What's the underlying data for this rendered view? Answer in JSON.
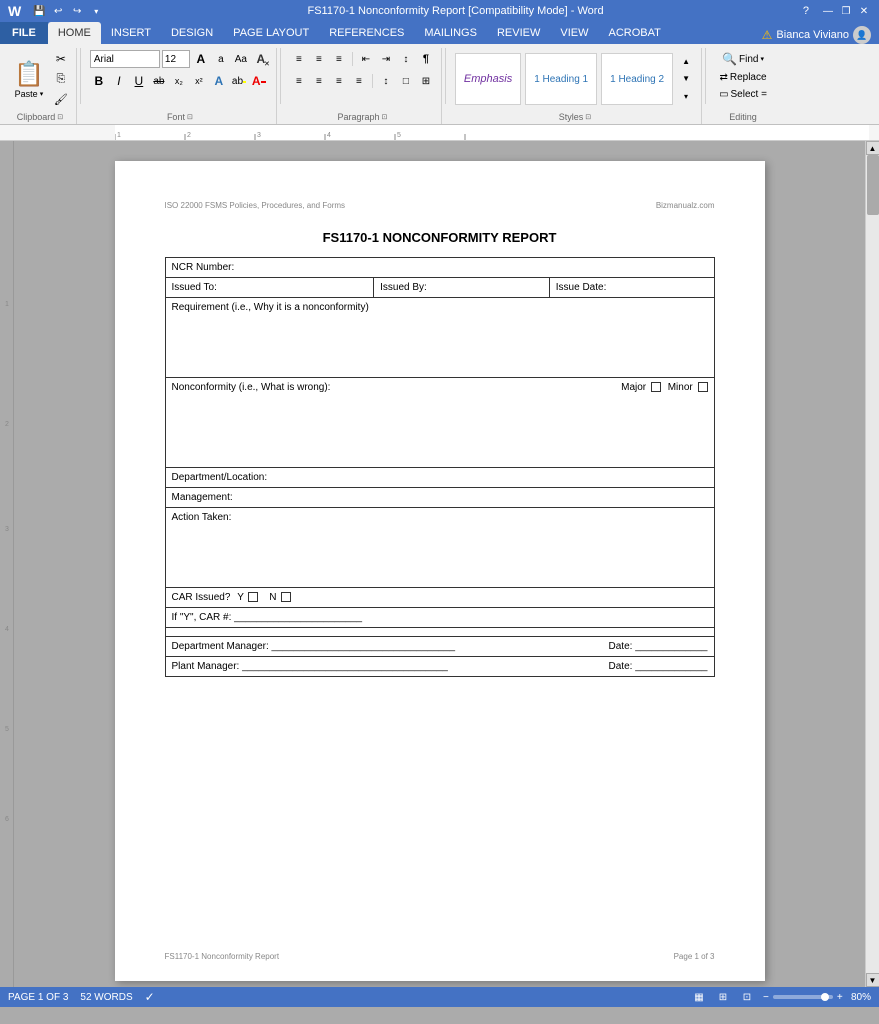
{
  "titleBar": {
    "title": "FS1170-1 Nonconformity Report [Compatibility Mode] - Word",
    "helpBtn": "?",
    "minimizeBtn": "—",
    "restoreBtn": "❐",
    "closeBtn": "✕"
  },
  "quickAccess": {
    "save": "💾",
    "undo": "↩",
    "redo": "↪",
    "more": "▾"
  },
  "ribbonTabs": {
    "file": "FILE",
    "tabs": [
      "HOME",
      "INSERT",
      "DESIGN",
      "PAGE LAYOUT",
      "REFERENCES",
      "MAILINGS",
      "REVIEW",
      "VIEW",
      "ACROBAT"
    ],
    "activeTab": "HOME"
  },
  "user": {
    "warningIcon": "⚠",
    "name": "Bianca Viviano"
  },
  "ribbon": {
    "clipboard": {
      "label": "Clipboard",
      "pasteLabel": "Paste",
      "cutLabel": "✂",
      "copyLabel": "⎘",
      "formatPainterLabel": "🖌"
    },
    "font": {
      "label": "Font",
      "fontName": "Arial",
      "fontSize": "12",
      "growLabel": "A",
      "shrinkLabel": "a",
      "caseLabel": "Aa",
      "clearLabel": "A",
      "boldLabel": "B",
      "italicLabel": "I",
      "underlineLabel": "U",
      "strikeLabel": "ab",
      "subscriptLabel": "x₂",
      "superscriptLabel": "x²",
      "textEffectsLabel": "A",
      "highlightLabel": "ab",
      "fontColorLabel": "A"
    },
    "paragraph": {
      "label": "Paragraph",
      "bulletsLabel": "≡",
      "numberingLabel": "≡",
      "multiLabel": "≡",
      "decreaseIndentLabel": "←",
      "increaseIndentLabel": "→",
      "sortLabel": "↕",
      "showMarkLabel": "¶",
      "alignLeftLabel": "≡",
      "centerLabel": "≡",
      "alignRightLabel": "≡",
      "justifyLabel": "≡",
      "lineSpacingLabel": "↕",
      "shadingLabel": "□",
      "bordersLabel": "□"
    },
    "styles": {
      "label": "Styles",
      "items": [
        {
          "name": "Emphasis",
          "display": "Emphasis",
          "style": "emphasis"
        },
        {
          "name": "1 Heading 1",
          "display": "1 Heading 1",
          "style": "h1"
        },
        {
          "name": "1 Heading 2",
          "display": "1 Heading 2",
          "style": "h2"
        }
      ],
      "expandLabel": "▾"
    },
    "editing": {
      "label": "Editing",
      "findLabel": "Find",
      "replaceLabel": "Replace",
      "selectLabel": "Select ="
    }
  },
  "document": {
    "headerLeft": "ISO 22000 FSMS Policies, Procedures, and Forms",
    "headerRight": "Bizmanualz.com",
    "title": "FS1170-1 NONCONFORMITY REPORT",
    "table": {
      "ncrNumber": "NCR Number:",
      "issuedTo": "Issued To:",
      "issuedBy": "Issued By:",
      "issueDate": "Issue Date:",
      "requirement": "Requirement (i.e., Why it is a nonconformity)",
      "nonconformity": "Nonconformity (i.e., What is wrong):",
      "major": "Major",
      "minor": "Minor",
      "departmentLocation": "Department/Location:",
      "management": "Management:",
      "actionTaken": "Action Taken:",
      "carIssued": "CAR Issued?",
      "carY": "Y",
      "carN": "N",
      "ifY": "If \"Y\", CAR #: _______________________",
      "deptManager": "Department Manager: _________________________________",
      "deptManagerDate": "Date: _____________",
      "plantManager": "Plant Manager: _____________________________________",
      "plantManagerDate": "Date: _____________"
    },
    "footerLeft": "FS1170-1 Nonconformity Report",
    "footerRight": "Page 1 of 3"
  },
  "statusBar": {
    "page": "PAGE 1 OF 3",
    "words": "52 WORDS",
    "proofingIcon": "✓",
    "viewPrint": "▦",
    "viewFull": "⊞",
    "viewWeb": "⊡",
    "zoomLevel": "80%"
  }
}
